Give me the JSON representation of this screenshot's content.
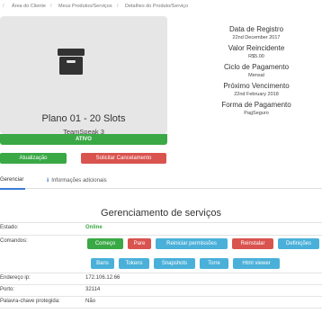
{
  "breadcrumb": [
    "Área do Cliente",
    "Meus Produtos/Serviços",
    "Detalhes do Produto/Serviço"
  ],
  "product": {
    "name": "Plano 01 - 20 Slots",
    "group": "TeamSpeak 3",
    "status": "ATIVO",
    "icon": "box-archive-icon"
  },
  "actions": {
    "upgrade": "Atualização",
    "cancel": "Solicitar Cancelamento"
  },
  "info": {
    "registration_label": "Data de Registro",
    "registration_value": "22nd December 2017",
    "recurring_label": "Valor Reincidente",
    "recurring_value": "R$5.00",
    "cycle_label": "Ciclo de Pagamento",
    "cycle_value": "Mensal",
    "next_due_label": "Próximo Vencimento",
    "next_due_value": "22nd February 2018",
    "payment_label": "Forma de Pagamento",
    "payment_value": "PagSeguro"
  },
  "tabs": {
    "manage": "Gerenciar",
    "additional": "Informações adicionais",
    "info_icon": "info-icon"
  },
  "management": {
    "title": "Gerenciamento de serviços",
    "status_label": "Estado:",
    "status_value": "Online",
    "commands_label": "Comandos:",
    "ip_label": "Endereço ip:",
    "ip_value": "172.106.12.66",
    "port_label": "Porto:",
    "port_value": "32114",
    "password_label": "Palavra-chave protegida:",
    "password_value": "Não"
  },
  "commands": {
    "start": "Começo",
    "stop": "Pare",
    "restart_permissions": "Reiniciar permissões",
    "reinstall": "Reinstalar",
    "settings": "Definições",
    "bans": "Bans",
    "tokens": "Tokens",
    "snapshots": "Snapshots",
    "tower": "Torre",
    "viewer": "Html viewer"
  },
  "colors": {
    "success": "#3aa845",
    "danger": "#d9534f",
    "info": "#4ab0d9",
    "tab_accent": "#3a7bd5"
  }
}
